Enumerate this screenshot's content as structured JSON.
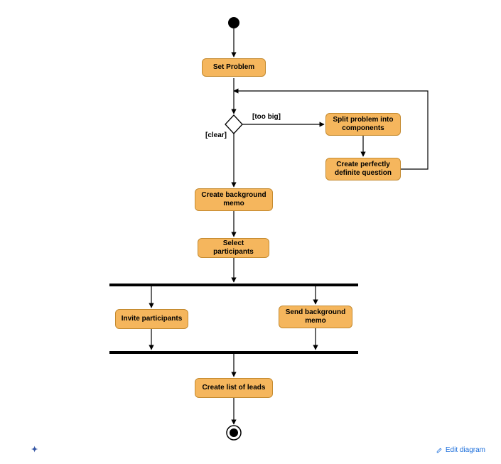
{
  "nodes": {
    "set_problem": "Set Problem",
    "split": "Split problem into components",
    "cpdq": "Create perfectly definite question",
    "bg_memo": "Create background memo",
    "select_participants": "Select participants",
    "invite": "Invite participants",
    "send_memo": "Send background memo",
    "leads": "Create list of leads"
  },
  "guards": {
    "too_big": "[too big]",
    "clear": "[clear]"
  },
  "links": {
    "edit": "Edit diagram"
  }
}
